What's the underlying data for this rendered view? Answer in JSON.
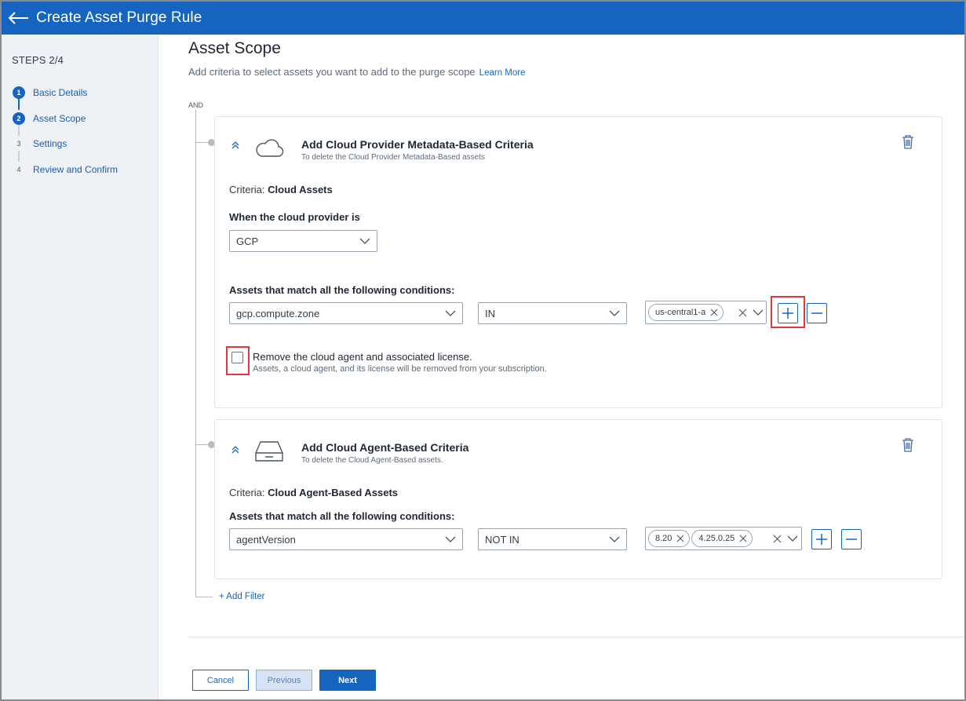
{
  "header": {
    "title": "Create Asset Purge Rule"
  },
  "sidebar": {
    "steps_label": "STEPS 2/4",
    "steps": [
      {
        "number": "1",
        "label": "Basic Details",
        "state": "done"
      },
      {
        "number": "2",
        "label": "Asset Scope",
        "state": "current"
      },
      {
        "number": "3",
        "label": "Settings",
        "state": "todo"
      },
      {
        "number": "4",
        "label": "Review and Confirm",
        "state": "todo"
      }
    ]
  },
  "main": {
    "title": "Asset Scope",
    "subtitle": "Add criteria to select assets you want to add to the purge scope",
    "learn_more": "Learn More",
    "operator": "AND",
    "cloud_card": {
      "title": "Add Cloud Provider Metadata-Based Criteria",
      "subtitle": "To delete the Cloud Provider Metadata-Based assets",
      "criteria_prefix": "Criteria:",
      "criteria_value": "Cloud Assets",
      "provider_label": "When the cloud provider is",
      "provider_value": "GCP",
      "conditions_label": "Assets that match all the following conditions:",
      "field_value": "gcp.compute.zone",
      "operator_value": "IN",
      "tags": [
        "us-central1-a"
      ],
      "checkbox_label": "Remove the cloud agent and associated license.",
      "checkbox_sub": "Assets, a cloud agent, and its license will be removed from your subscription.",
      "checkbox_checked": false
    },
    "agent_card": {
      "title": "Add Cloud Agent-Based Criteria",
      "subtitle": "To delete the Cloud Agent-Based assets.",
      "criteria_prefix": "Criteria:",
      "criteria_value": "Cloud Agent-Based Assets",
      "conditions_label": "Assets that match all the following conditions:",
      "field_value": "agentVersion",
      "operator_value": "NOT IN",
      "tags": [
        "8.20",
        "4.25.0.25"
      ]
    },
    "add_filter": "+ Add Filter"
  },
  "footer": {
    "cancel": "Cancel",
    "previous": "Previous",
    "next": "Next"
  },
  "colors": {
    "accent": "#1565c0",
    "highlight": "#e03a3e",
    "sidebar_bg": "#eef1f6"
  }
}
